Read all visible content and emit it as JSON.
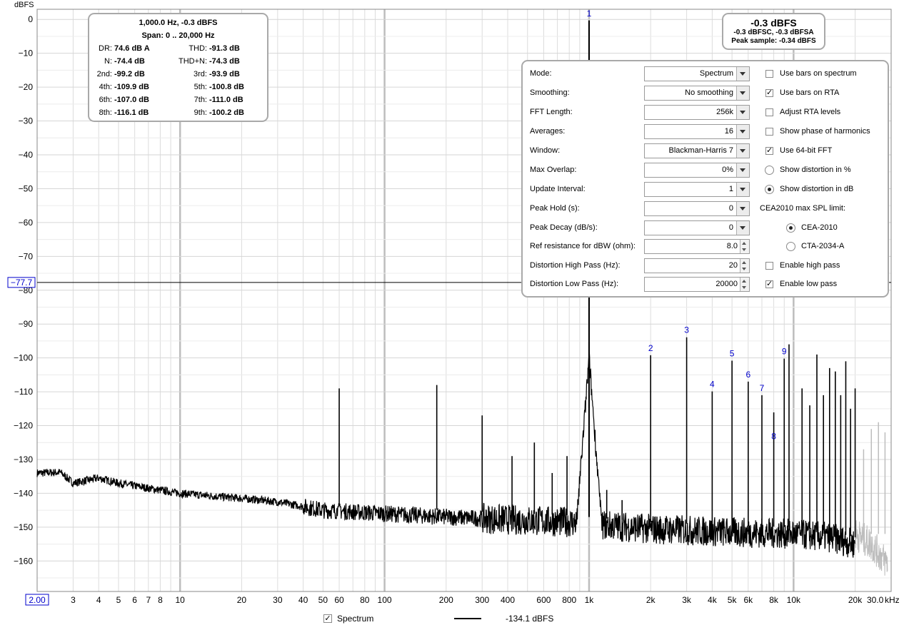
{
  "chart_data": {
    "type": "line",
    "ylabel": "dBFS",
    "x_unit": "kHz",
    "x_scale": "log",
    "xlim": [
      2.0,
      30000
    ],
    "ylim": [
      -169,
      3
    ],
    "grid": true,
    "x_tick_labels": [
      {
        "f": 3,
        "label": "3"
      },
      {
        "f": 4,
        "label": "4"
      },
      {
        "f": 5,
        "label": "5"
      },
      {
        "f": 6,
        "label": "6"
      },
      {
        "f": 7,
        "label": "7"
      },
      {
        "f": 8,
        "label": "8"
      },
      {
        "f": 10,
        "label": "10"
      },
      {
        "f": 20,
        "label": "20"
      },
      {
        "f": 30,
        "label": "30"
      },
      {
        "f": 40,
        "label": "40"
      },
      {
        "f": 50,
        "label": "50"
      },
      {
        "f": 60,
        "label": "60"
      },
      {
        "f": 80,
        "label": "80"
      },
      {
        "f": 100,
        "label": "100"
      },
      {
        "f": 200,
        "label": "200"
      },
      {
        "f": 300,
        "label": "300"
      },
      {
        "f": 400,
        "label": "400"
      },
      {
        "f": 600,
        "label": "600"
      },
      {
        "f": 800,
        "label": "800"
      },
      {
        "f": 1000,
        "label": "1k"
      },
      {
        "f": 2000,
        "label": "2k"
      },
      {
        "f": 3000,
        "label": "3k"
      },
      {
        "f": 4000,
        "label": "4k"
      },
      {
        "f": 5000,
        "label": "5k"
      },
      {
        "f": 6000,
        "label": "6k"
      },
      {
        "f": 8000,
        "label": "8k"
      },
      {
        "f": 10000,
        "label": "10k"
      },
      {
        "f": 20000,
        "label": "20k"
      }
    ],
    "x_min_label": "2.00",
    "x_max_label": "30.0",
    "y_ticks": [
      0,
      -10,
      -20,
      -30,
      -40,
      -50,
      -60,
      -70,
      -80,
      -90,
      -100,
      -110,
      -120,
      -130,
      -140,
      -150,
      -160
    ],
    "cursor_y": -77.7,
    "cursor_label": "-77.7",
    "series": [
      {
        "name": "Spectrum",
        "color": "#000000",
        "noise_floor": [
          [
            2,
            -134
          ],
          [
            2.6,
            -133.8
          ],
          [
            3,
            -137
          ],
          [
            4,
            -135.5
          ],
          [
            5,
            -137
          ],
          [
            7,
            -138.5
          ],
          [
            10,
            -140
          ],
          [
            20,
            -141.5
          ],
          [
            30,
            -142.5
          ],
          [
            50,
            -145
          ],
          [
            100,
            -146
          ],
          [
            200,
            -147
          ],
          [
            500,
            -148
          ],
          [
            800,
            -148.5
          ],
          [
            2000,
            -150.5
          ],
          [
            5000,
            -151.5
          ],
          [
            10000,
            -152
          ],
          [
            15000,
            -153
          ],
          [
            20000,
            -155
          ]
        ],
        "noise_floor_extension_color": "#bdbdbd",
        "noise_floor_extension": [
          [
            20000,
            -152
          ],
          [
            24000,
            -155
          ],
          [
            28000,
            -160
          ]
        ],
        "peaks": [
          {
            "f": 60,
            "db": -109
          },
          {
            "f": 180,
            "db": -108
          },
          {
            "f": 300,
            "db": -117
          },
          {
            "f": 420,
            "db": -129
          },
          {
            "f": 540,
            "db": -125
          },
          {
            "f": 660,
            "db": -134
          },
          {
            "f": 780,
            "db": -129
          },
          {
            "f": 1000,
            "db": -0.3
          },
          {
            "f": 1220,
            "db": -139
          },
          {
            "f": 1450,
            "db": -142
          },
          {
            "f": 2000,
            "db": -99.2
          },
          {
            "f": 3000,
            "db": -93.9
          },
          {
            "f": 4000,
            "db": -109.9
          },
          {
            "f": 5000,
            "db": -100.8
          },
          {
            "f": 6000,
            "db": -107.0
          },
          {
            "f": 7000,
            "db": -111.0
          },
          {
            "f": 8000,
            "db": -116.1
          },
          {
            "f": 9000,
            "db": -100.2
          },
          {
            "f": 9500,
            "db": -96
          },
          {
            "f": 11000,
            "db": -109
          },
          {
            "f": 12000,
            "db": -114
          },
          {
            "f": 13000,
            "db": -99
          },
          {
            "f": 14000,
            "db": -111
          },
          {
            "f": 15000,
            "db": -103
          },
          {
            "f": 16000,
            "db": -104
          },
          {
            "f": 17000,
            "db": -111
          },
          {
            "f": 18000,
            "db": -101
          },
          {
            "f": 19000,
            "db": -115
          },
          {
            "f": 20000,
            "db": -109
          }
        ],
        "ghost_peaks": [
          {
            "f": 22000,
            "db": -127
          },
          {
            "f": 24000,
            "db": -121
          },
          {
            "f": 26000,
            "db": -119
          },
          {
            "f": 28000,
            "db": -122
          }
        ],
        "peak_markers": [
          {
            "f": 1000,
            "db": -0.3,
            "label": "1"
          },
          {
            "f": 2000,
            "db": -99.2,
            "label": "2"
          },
          {
            "f": 3000,
            "db": -93.9,
            "label": "3"
          },
          {
            "f": 4000,
            "db": -109.9,
            "label": "4"
          },
          {
            "f": 5000,
            "db": -100.8,
            "label": "5"
          },
          {
            "f": 6000,
            "db": -107.0,
            "label": "6"
          },
          {
            "f": 7000,
            "db": -111.0,
            "label": "7"
          },
          {
            "f": 8000,
            "db": -116.1,
            "label": "8"
          },
          {
            "f": 9000,
            "db": -100.2,
            "label": "9"
          }
        ]
      }
    ]
  },
  "info_box": {
    "title": "1,000.0 Hz, -0.3 dBFS",
    "span": "Span: 0 .. 20,000 Hz",
    "rows": [
      {
        "l1": "DR:",
        "v1": "74.6 dB A",
        "l2": "THD:",
        "v2": "-91.3 dB"
      },
      {
        "l1": "N:",
        "v1": "-74.4 dB",
        "l2": "THD+N:",
        "v2": "-74.3 dB"
      },
      {
        "l1": "2nd:",
        "v1": "-99.2 dB",
        "l2": "3rd:",
        "v2": "-93.9 dB"
      },
      {
        "l1": "4th:",
        "v1": "-109.9 dB",
        "l2": "5th:",
        "v2": "-100.8 dB"
      },
      {
        "l1": "6th:",
        "v1": "-107.0 dB",
        "l2": "7th:",
        "v2": "-111.0 dB"
      },
      {
        "l1": "8th:",
        "v1": "-116.1 dB",
        "l2": "9th:",
        "v2": "-100.2 dB"
      }
    ]
  },
  "level_box": {
    "main": "-0.3 dBFS",
    "sub": "-0.3 dBFSC, -0.3 dBFSA",
    "peak": "Peak sample: -0.34 dBFS"
  },
  "settings": {
    "rows": [
      {
        "label": "Mode:",
        "kind": "combo",
        "value": "Spectrum",
        "opt_kind": "check",
        "opt_checked": false,
        "opt_label": "Use bars on spectrum"
      },
      {
        "label": "Smoothing:",
        "kind": "combo",
        "value": "No  smoothing",
        "opt_kind": "check",
        "opt_checked": true,
        "opt_label": "Use bars on RTA"
      },
      {
        "label": "FFT Length:",
        "kind": "combo",
        "value": "256k",
        "opt_kind": "check",
        "opt_checked": false,
        "opt_label": "Adjust RTA levels"
      },
      {
        "label": "Averages:",
        "kind": "combo",
        "value": "16",
        "opt_kind": "check",
        "opt_checked": false,
        "opt_label": "Show phase of harmonics"
      },
      {
        "label": "Window:",
        "kind": "combo",
        "value": "Blackman-Harris 7",
        "opt_kind": "check",
        "opt_checked": true,
        "opt_label": "Use 64-bit FFT"
      },
      {
        "label": "Max Overlap:",
        "kind": "combo",
        "value": "0%",
        "opt_kind": "radio",
        "opt_checked": false,
        "opt_label": "Show distortion in %"
      },
      {
        "label": "Update Interval:",
        "kind": "combo",
        "value": "1",
        "opt_kind": "radio",
        "opt_checked": true,
        "opt_label": "Show distortion in dB"
      },
      {
        "label": "Peak Hold (s):",
        "kind": "combo",
        "value": "0",
        "opt_kind": "text",
        "opt_checked": false,
        "opt_label": "CEA2010 max SPL limit:"
      },
      {
        "label": "Peak Decay (dB/s):",
        "kind": "combo",
        "value": "0",
        "opt_kind": "radio-indent",
        "opt_checked": true,
        "opt_label": "CEA-2010"
      },
      {
        "label": "Ref resistance for dBW (ohm):",
        "kind": "spin",
        "value": "8.0",
        "opt_kind": "radio-indent",
        "opt_checked": false,
        "opt_label": "CTA-2034-A"
      },
      {
        "label": "Distortion High Pass (Hz):",
        "kind": "spin",
        "value": "20",
        "opt_kind": "check",
        "opt_checked": false,
        "opt_label": "Enable high pass"
      },
      {
        "label": "Distortion Low Pass (Hz):",
        "kind": "spin",
        "value": "20000",
        "opt_kind": "check",
        "opt_checked": true,
        "opt_label": "Enable low pass"
      }
    ]
  },
  "legend": {
    "checked": true,
    "label": "Spectrum",
    "value": "-134.1 dBFS"
  }
}
